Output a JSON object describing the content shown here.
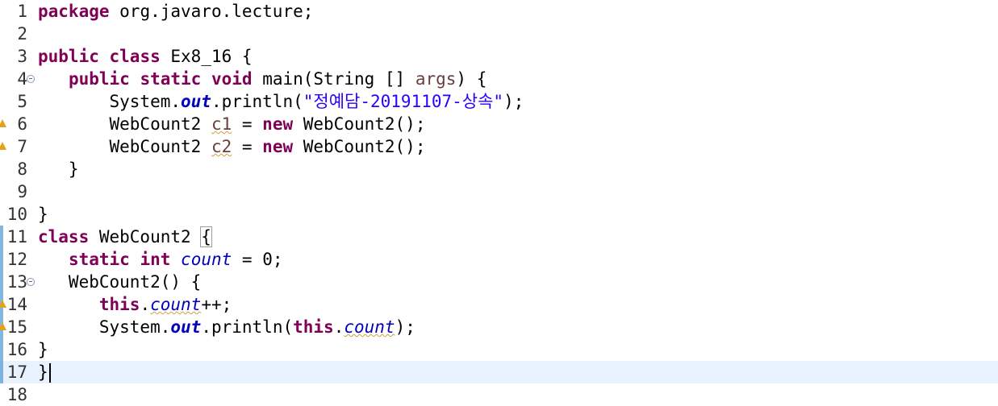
{
  "editor": {
    "language": "java",
    "current_line": 17,
    "lines": [
      {
        "n": "1",
        "parts": [
          {
            "t": "package",
            "c": "kw"
          },
          {
            "t": " org.javaro.lecture;"
          }
        ]
      },
      {
        "n": "2",
        "parts": []
      },
      {
        "n": "3",
        "parts": [
          {
            "t": "public",
            "c": "kw"
          },
          {
            "t": " "
          },
          {
            "t": "class",
            "c": "kw"
          },
          {
            "t": " Ex8_16 {"
          }
        ]
      },
      {
        "n": "4",
        "fold": true,
        "parts": [
          {
            "t": "   "
          },
          {
            "t": "public",
            "c": "kw"
          },
          {
            "t": " "
          },
          {
            "t": "static",
            "c": "kw"
          },
          {
            "t": " "
          },
          {
            "t": "void",
            "c": "kw"
          },
          {
            "t": " main(String [] "
          },
          {
            "t": "args",
            "c": "param"
          },
          {
            "t": ") {"
          }
        ]
      },
      {
        "n": "5",
        "parts": [
          {
            "t": "       System."
          },
          {
            "t": "out",
            "c": "sfld"
          },
          {
            "t": ".println("
          },
          {
            "t": "\"정예담-20191107-상속\"",
            "c": "str"
          },
          {
            "t": ");"
          }
        ]
      },
      {
        "n": "6",
        "warning": true,
        "parts": [
          {
            "t": "       WebCount2 "
          },
          {
            "t": "c1",
            "c": "lvar"
          },
          {
            "t": " = "
          },
          {
            "t": "new",
            "c": "kw"
          },
          {
            "t": " WebCount2();"
          }
        ]
      },
      {
        "n": "7",
        "warning": true,
        "parts": [
          {
            "t": "       WebCount2 "
          },
          {
            "t": "c2",
            "c": "lvar"
          },
          {
            "t": " = "
          },
          {
            "t": "new",
            "c": "kw"
          },
          {
            "t": " WebCount2();"
          }
        ]
      },
      {
        "n": "8",
        "parts": [
          {
            "t": "   }"
          }
        ]
      },
      {
        "n": "9",
        "parts": []
      },
      {
        "n": "10",
        "parts": [
          {
            "t": "}"
          }
        ]
      },
      {
        "n": "11",
        "quickdiff": true,
        "parts": [
          {
            "t": "class",
            "c": "kw"
          },
          {
            "t": " WebCount2 "
          },
          {
            "t": "{",
            "c": "bracket"
          }
        ]
      },
      {
        "n": "12",
        "quickdiff": true,
        "parts": [
          {
            "t": "   "
          },
          {
            "t": "static",
            "c": "kw"
          },
          {
            "t": " "
          },
          {
            "t": "int",
            "c": "kw"
          },
          {
            "t": " "
          },
          {
            "t": "count",
            "c": "fld"
          },
          {
            "t": " = 0;"
          }
        ]
      },
      {
        "n": "13",
        "quickdiff": true,
        "fold": true,
        "parts": [
          {
            "t": "   WebCount2() {"
          }
        ]
      },
      {
        "n": "14",
        "quickdiff": true,
        "warning": true,
        "parts": [
          {
            "t": "      "
          },
          {
            "t": "this",
            "c": "kw"
          },
          {
            "t": "."
          },
          {
            "t": "count",
            "c": "wfld"
          },
          {
            "t": "++;"
          }
        ]
      },
      {
        "n": "15",
        "quickdiff": true,
        "warning": true,
        "parts": [
          {
            "t": "      System."
          },
          {
            "t": "out",
            "c": "sfld"
          },
          {
            "t": ".println("
          },
          {
            "t": "this",
            "c": "kw"
          },
          {
            "t": "."
          },
          {
            "t": "count",
            "c": "wfld"
          },
          {
            "t": ");"
          }
        ]
      },
      {
        "n": "16",
        "quickdiff": true,
        "parts": [
          {
            "t": "}"
          }
        ]
      },
      {
        "n": "17",
        "quickdiff": true,
        "caret": true,
        "parts": [
          {
            "t": "}"
          }
        ]
      },
      {
        "n": "18",
        "parts": []
      }
    ]
  }
}
